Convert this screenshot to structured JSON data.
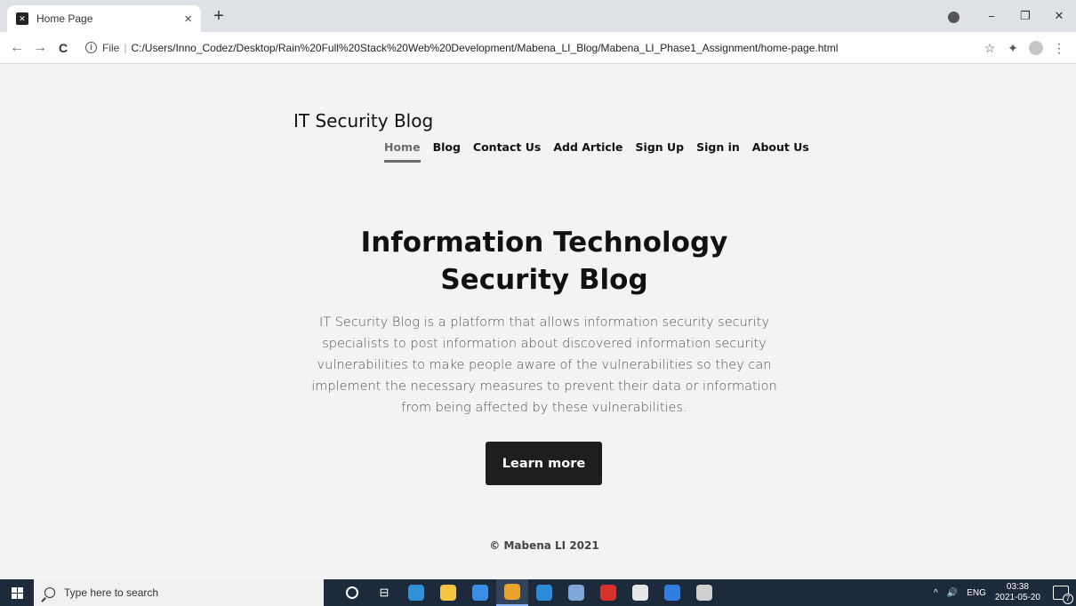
{
  "browser": {
    "tab_title": "Home Page",
    "tab_close": "×",
    "new_tab": "+",
    "file_label": "File",
    "separator": "|",
    "url": "C:/Users/Inno_Codez/Desktop/Rain%20Full%20Stack%20Web%20Development/Mabena_LI_Blog/Mabena_LI_Phase1_Assignment/home-page.html",
    "window_controls": {
      "minimize": "−",
      "restore": "❐",
      "close": "✕"
    },
    "nav": {
      "back": "←",
      "forward": "→",
      "reload": "C"
    },
    "info": "i",
    "right_icons": {
      "star": "☆",
      "extensions": "✦",
      "menu": "⋮"
    }
  },
  "page": {
    "brand": "IT Security Blog",
    "nav_items": [
      "Home",
      "Blog",
      "Contact Us",
      "Add Article",
      "Sign Up",
      "Sign in",
      "About Us"
    ],
    "active_nav": "Home",
    "hero_title": "Information Technology Security Blog",
    "hero_text": "IT Security Blog is a platform that allows information security security specialists to post information about discovered information security vulnerabilities to make people aware of the vulnerabilities so they can implement the necessary measures to prevent their data or information from being affected by these vulnerabilities.",
    "cta_label": "Learn more",
    "footer": "© Mabena LI 2021"
  },
  "taskbar": {
    "search_placeholder": "Type here to search",
    "tray_language": "ENG",
    "tray_chevron": "^",
    "tray_sound": "🔊",
    "time": "03:38",
    "date": "2021-05-20",
    "notification_count": "7",
    "apps": [
      {
        "name": "edge-icon",
        "color": "#2f8fd8"
      },
      {
        "name": "file-explorer-icon",
        "color": "#f4c542"
      },
      {
        "name": "mail-icon",
        "color": "#3a8ee6"
      },
      {
        "name": "chrome-icon",
        "color": "#e8a32b"
      },
      {
        "name": "vscode-icon",
        "color": "#2b8ad9"
      },
      {
        "name": "notes-icon",
        "color": "#7ea6d8"
      },
      {
        "name": "acrobat-icon",
        "color": "#d8312a"
      },
      {
        "name": "slack-icon",
        "color": "#e6e6e6"
      },
      {
        "name": "firefox-icon",
        "color": "#2f7fe0"
      },
      {
        "name": "terminal-icon",
        "color": "#cfcfcf"
      }
    ]
  }
}
